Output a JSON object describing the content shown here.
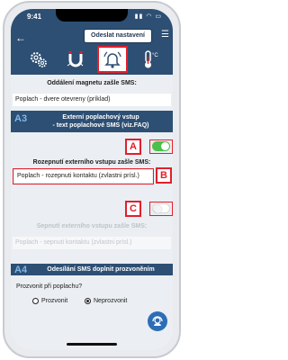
{
  "statusbar": {
    "time": "9:41",
    "icons": "▮▮ ◠ ▭"
  },
  "toolbar": {
    "back_label": "←",
    "send_label": "Odeslat nastavení",
    "menu_label": "☰"
  },
  "tabs": [
    {
      "name": "settings",
      "icon": "gears-icon"
    },
    {
      "name": "magnet",
      "icon": "magnet-icon"
    },
    {
      "name": "alarm",
      "icon": "bell-icon",
      "active": true
    },
    {
      "name": "temperature",
      "icon": "thermometer-icon"
    }
  ],
  "magnet": {
    "label": "Oddálení magnetu zašle SMS:",
    "value": "Poplach - dvere otevreny (príklad)"
  },
  "sectionA3": {
    "num": "A3",
    "title_line1": "Externí poplachový vstup",
    "title_line2": "- text poplachové SMS (viz.FAQ)"
  },
  "toggle_a": {
    "marker": "A",
    "state": "on",
    "color": "#4cc04c"
  },
  "rozepnuti": {
    "label": "Rozepnutí externího vstupu zašle SMS:",
    "value": "Poplach - rozepnuti kontaktu (zvlastni prísl.)",
    "marker": "B"
  },
  "toggle_c": {
    "marker": "C",
    "state": "off"
  },
  "sepnuti": {
    "label": "Sepnutí externího vstupu zašle SMS:",
    "value": "Poplach - sepnuti kontaktu (zvlastni prísl.)"
  },
  "sectionA4": {
    "num": "A4",
    "title": "Odesílání SMS doplnit prozvoněním"
  },
  "prozvonit": {
    "question": "Prozvonit při poplachu?",
    "options": [
      {
        "label": "Prozvonit",
        "selected": false
      },
      {
        "label": "Neprozvonit",
        "selected": true
      }
    ]
  },
  "colors": {
    "header": "#2d4f73",
    "accent": "#e0202c",
    "toggle_on": "#4cc04c",
    "fab": "#2d6db6"
  }
}
